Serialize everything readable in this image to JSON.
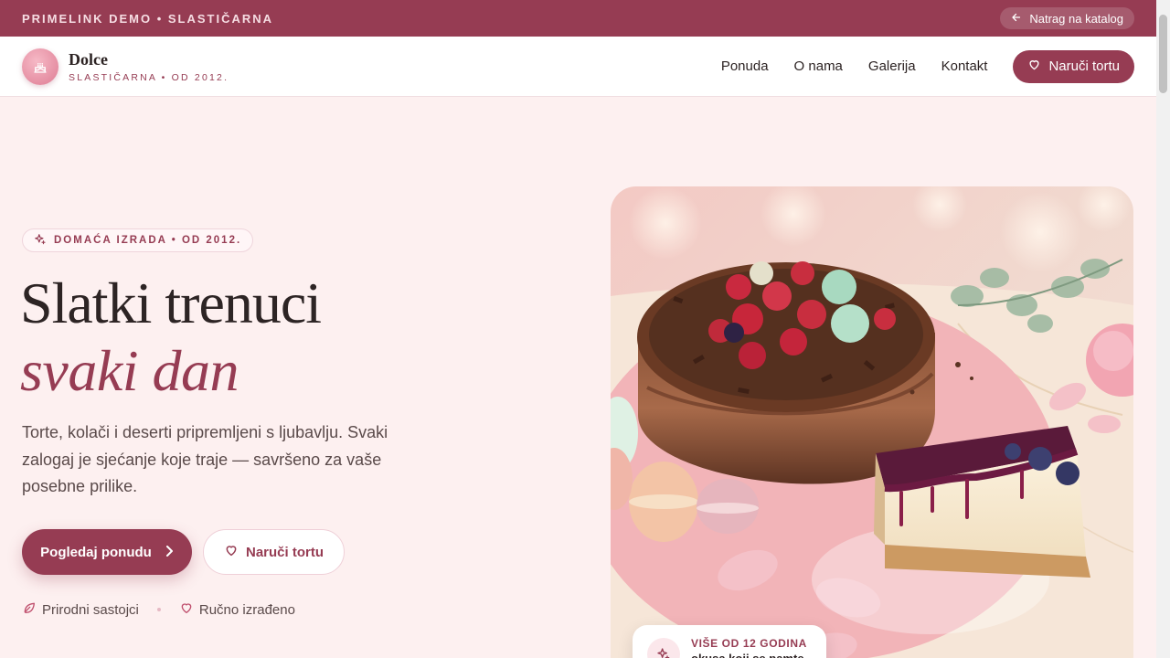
{
  "topbar": {
    "title": "PRIMELINK DEMO • SLASTIČARNA",
    "back_label": "Natrag na katalog"
  },
  "header": {
    "brand_name": "Dolce",
    "brand_sub": "SLASTIČARNA • OD 2012.",
    "nav": [
      "Ponuda",
      "O nama",
      "Galerija",
      "Kontakt"
    ],
    "order_label": "Naruči tortu"
  },
  "hero": {
    "badge": "DOMAĆA IZRADA • OD 2012.",
    "title_line1": "Slatki trenuci",
    "title_line2": "svaki dan",
    "lead": "Torte, kolači i deserti pripremljeni s ljubavlju. Svaki zalogaj je sjećanje koje traje — savršeno za vaše posebne prilike.",
    "primary_cta": "Pogledaj ponudu",
    "secondary_cta": "Naruči tortu",
    "features": [
      "Prirodni sastojci",
      "Ručno izrađeno"
    ]
  },
  "float_card": {
    "title": "VIŠE OD 12 GODINA",
    "subtitle": "okusa koji se pamte"
  },
  "icons": {
    "back": "arrow-left-icon",
    "logo": "cake-icon",
    "order": "heart-icon",
    "badge": "sparkles-icon",
    "primary_cta": "chevron-right-icon",
    "feature_1": "leaf-icon",
    "feature_2": "heart-icon"
  },
  "colors": {
    "brand": "#963c53",
    "background": "#fdf0f0",
    "text": "#2d2424"
  }
}
